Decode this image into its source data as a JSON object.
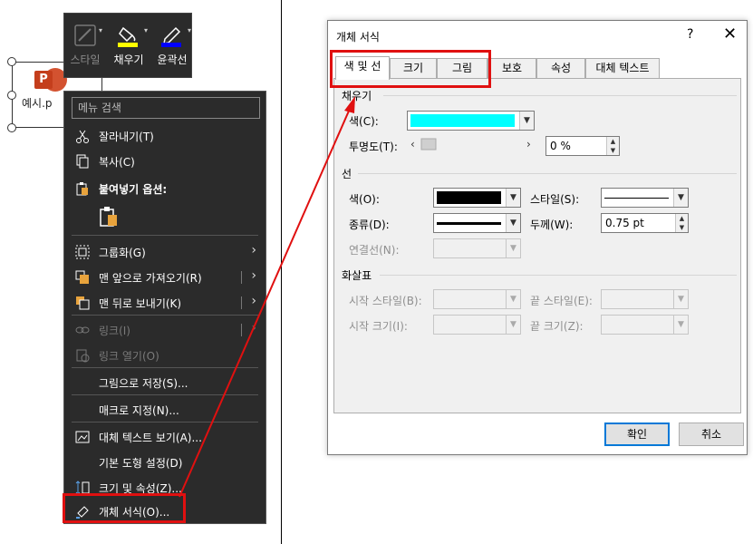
{
  "slide": {
    "file_label": "예시.p"
  },
  "mini_toolbar": {
    "style_label": "스타일",
    "fill_label": "채우기",
    "outline_label": "윤곽선",
    "fill_color": "#ffff00",
    "outline_color": "#0000ff"
  },
  "context_menu": {
    "search_placeholder": "메뉴 검색",
    "items": [
      {
        "label": "잘라내기(T)",
        "icon": "scissors-icon"
      },
      {
        "label": "복사(C)",
        "icon": "copy-icon"
      },
      {
        "label": "붙여넣기 옵션:",
        "icon": "paste-icon"
      },
      {
        "label": "",
        "icon": "paste-option-icon"
      },
      {
        "label": "그룹화(G)",
        "icon": "group-icon"
      },
      {
        "label": "맨 앞으로 가져오기(R)",
        "icon": "bring-front-icon"
      },
      {
        "label": "맨 뒤로 보내기(K)",
        "icon": "send-back-icon"
      },
      {
        "label": "링크(I)",
        "icon": "link-icon"
      },
      {
        "label": "링크 열기(O)",
        "icon": "open-link-icon"
      },
      {
        "label": "그림으로 저장(S)...",
        "icon": ""
      },
      {
        "label": "매크로 지정(N)...",
        "icon": ""
      },
      {
        "label": "대체 텍스트 보기(A)...",
        "icon": "alt-text-icon"
      },
      {
        "label": "기본 도형 설정(D)",
        "icon": ""
      },
      {
        "label": "크기 및 속성(Z)...",
        "icon": "size-icon"
      },
      {
        "label": "개체 서식(O)...",
        "icon": "format-icon"
      }
    ]
  },
  "dialog": {
    "title": "개체 서식",
    "help": "?",
    "close": "✕",
    "tabs": [
      "색 및 선",
      "크기",
      "그림",
      "보호",
      "속성",
      "대체 텍스트"
    ],
    "fill": {
      "group": "채우기",
      "color_label": "색(C):",
      "color_value": "#00ffff",
      "transparency_label": "투명도(T):",
      "transparency_value": "0 %"
    },
    "line": {
      "group": "선",
      "color_label": "색(O):",
      "color_value": "#000000",
      "style_label": "스타일(S):",
      "dash_label": "종류(D):",
      "weight_label": "두께(W):",
      "weight_value": "0.75 pt",
      "connector_label": "연결선(N):"
    },
    "arrows": {
      "group": "화살표",
      "begin_style_label": "시작 스타일(B):",
      "end_style_label": "끝 스타일(E):",
      "begin_size_label": "시작 크기(I):",
      "end_size_label": "끝 크기(Z):"
    },
    "ok_label": "확인",
    "cancel_label": "취소"
  },
  "highlight_color": "#e01010"
}
